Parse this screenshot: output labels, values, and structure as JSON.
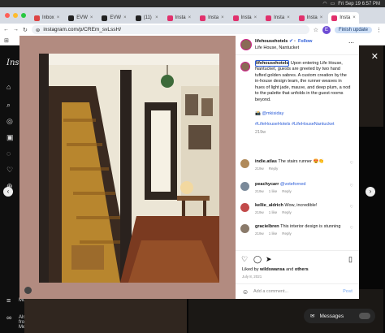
{
  "menubar": {
    "datetime": "Fri Sep 19  6:57 PM"
  },
  "tabs": [
    {
      "label": "Inbox",
      "fav": "#d44"
    },
    {
      "label": "EVW",
      "fav": "#222"
    },
    {
      "label": "EVW",
      "fav": "#222"
    },
    {
      "label": "(11)",
      "fav": "#222"
    },
    {
      "label": "Insta",
      "fav": "#e1306c"
    },
    {
      "label": "Insta",
      "fav": "#e1306c"
    },
    {
      "label": "Insta",
      "fav": "#e1306c"
    },
    {
      "label": "Insta",
      "fav": "#e1306c"
    },
    {
      "label": "Insta",
      "fav": "#e1306c"
    },
    {
      "label": "Insta",
      "fav": "#e1306c"
    }
  ],
  "toolbar": {
    "url": "instagram.com/p/CREm_svLssH/",
    "finish_label": "Finish update",
    "profile_initial": "E"
  },
  "sidebar": {
    "logo": "Instagram",
    "more_label": "More",
    "meta_label": "Also from Meta"
  },
  "post": {
    "username": "lifehousehotels",
    "verified_icon": "verified-badge-icon",
    "follow_label": "Follow",
    "location": "Life House, Nantucket",
    "caption_user": "lifehousehotels",
    "caption": "Upon entering Life House, Nantucket, guests are greeted by two hand tufted golden sabres. A custom creation by the in-house design team, the runner weaves in hues of light jade, mauve, and deep plum, a nod to the palette that unfolds in the guest rooms beyond.",
    "credit": "📸 @mkisiday",
    "hashtags": "#LifeHouseHotels #LifeHouseNantucket",
    "caption_time": "219w",
    "comments": [
      {
        "user": "indie.atlas",
        "text": "The stairs runner 😍👏",
        "time": "219w",
        "likes": "",
        "reply": "Reply"
      },
      {
        "user": "peachycarr",
        "text": "@voteforned",
        "time": "219w",
        "likes": "1 like",
        "reply": "Reply"
      },
      {
        "user": "kellie_aldrich",
        "text": "Wow, incredible!",
        "time": "219w",
        "likes": "1 like",
        "reply": "Reply"
      },
      {
        "user": "gracielbren",
        "text": "This interior design is stunning",
        "time": "219w",
        "likes": "1 like",
        "reply": "Reply"
      }
    ],
    "liked_by_prefix": "Liked by ",
    "liked_by_user": "wildswansa",
    "liked_by_suffix": " and ",
    "liked_by_others": "others",
    "date": "July 8, 2021",
    "add_comment_placeholder": "Add a comment...",
    "post_label": "Post"
  },
  "messages_label": "Messages"
}
